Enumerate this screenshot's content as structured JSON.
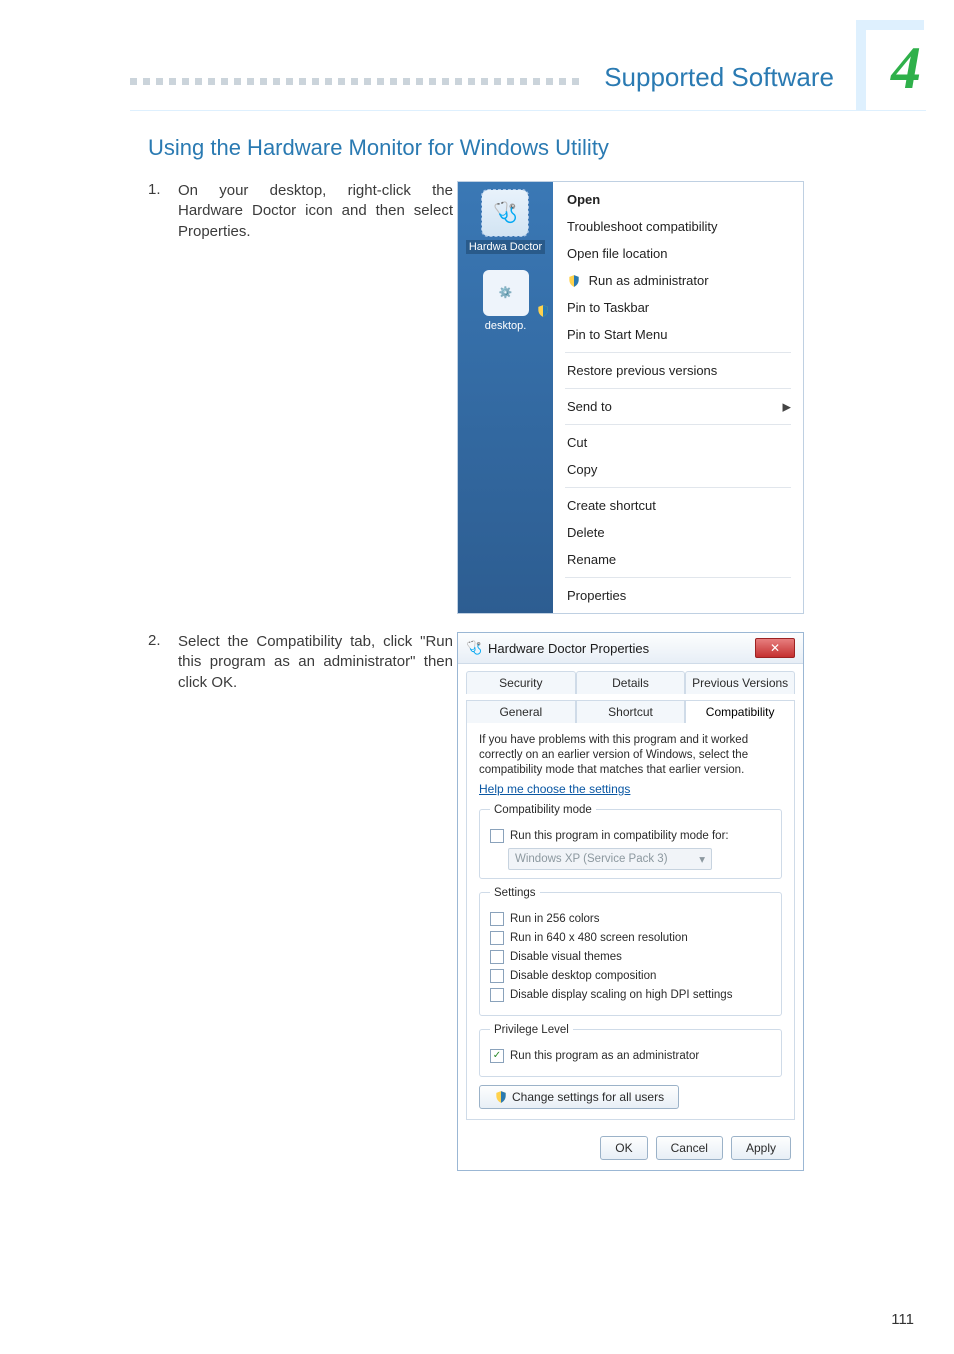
{
  "chapter_number": "4",
  "header_title": "Supported Software",
  "section_heading": "Using the Hardware Monitor for Windows Utility",
  "page_number": "111",
  "steps": [
    {
      "num": "1.",
      "text": "On your desktop, right-click the Hardware Doctor icon and then select Properties."
    },
    {
      "num": "2.",
      "text": "Select the Compatibility tab, click \"Run this program as an administrator\" then click OK."
    }
  ],
  "context_icons": {
    "hardware_doc_label": "Hardwa Doctor",
    "desktop_label": "desktop."
  },
  "context_menu": {
    "open": "Open",
    "troubleshoot": "Troubleshoot compatibility",
    "open_file": "Open file location",
    "run_admin": "Run as administrator",
    "pin_taskbar": "Pin to Taskbar",
    "pin_start": "Pin to Start Menu",
    "restore": "Restore previous versions",
    "send_to": "Send to",
    "cut": "Cut",
    "copy": "Copy",
    "create_shortcut": "Create shortcut",
    "delete": "Delete",
    "rename": "Rename",
    "properties": "Properties"
  },
  "dialog": {
    "title": "Hardware Doctor Properties",
    "tabs": {
      "security": "Security",
      "details": "Details",
      "previous": "Previous Versions",
      "general": "General",
      "shortcut": "Shortcut",
      "compat": "Compatibility"
    },
    "description": "If you have problems with this program and it worked correctly on an earlier version of Windows, select the compatibility mode that matches that earlier version.",
    "help_link": "Help me choose the settings",
    "compat_mode": {
      "legend": "Compatibility mode",
      "check": "Run this program in compatibility mode for:",
      "select": "Windows XP (Service Pack 3)"
    },
    "settings": {
      "legend": "Settings",
      "c1": "Run in 256 colors",
      "c2": "Run in 640 x 480 screen resolution",
      "c3": "Disable visual themes",
      "c4": "Disable desktop composition",
      "c5": "Disable display scaling on high DPI settings"
    },
    "privilege": {
      "legend": "Privilege Level",
      "check": "Run this program as an administrator"
    },
    "change_all": "Change settings for all users",
    "ok": "OK",
    "cancel": "Cancel",
    "apply": "Apply"
  }
}
